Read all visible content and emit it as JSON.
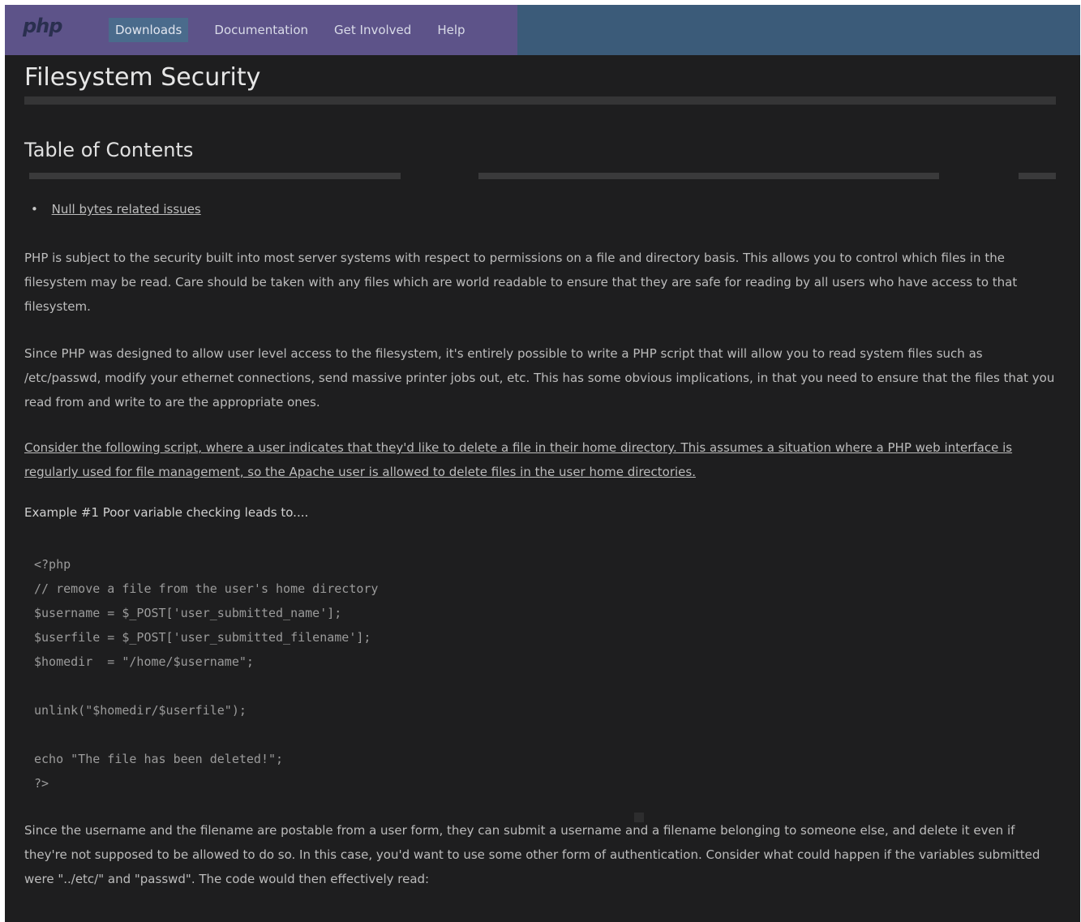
{
  "nav": {
    "logo": "php",
    "items": [
      "Downloads",
      "Documentation",
      "Get Involved",
      "Help"
    ]
  },
  "page": {
    "title": "Filesystem Security",
    "toc_title": "Table of Contents",
    "toc_items": [
      "Null bytes related issues"
    ]
  },
  "paragraphs": {
    "p1": "PHP is subject to the security built into most server systems with respect to permissions on a file and directory basis. This allows you to control which files in the filesystem may be read. Care should be taken with any files which are world readable to ensure that they are safe for reading by all users who have access to that filesystem.",
    "p2": "Since PHP was designed to allow user level access to the filesystem, it's entirely possible to write a PHP script that will allow you to read system files such as /etc/passwd, modify your ethernet connections, send massive printer jobs out, etc. This has some obvious implications, in that you need to ensure that the files that you read from and write to are the appropriate ones.",
    "p3_text": "Consider the following script, where a user indicates that they'd like to delete a file in their home directory. This assumes a situation where a PHP web interface is regularly used for file management, so the Apache user is allowed to delete files in the user home directories.",
    "p4": "Since the username and the filename are postable from a user form, they can submit a username and a filename belonging to someone else, and delete it even if they're not supposed to be allowed to do so. In this case, you'd want to use some other form of authentication. Consider what could happen if the variables submitted were \"../etc/\" and \"passwd\". The code would then effectively read:"
  },
  "example": {
    "title": "Example #1 Poor variable checking leads to....",
    "code_lines": [
      "<?php",
      "// remove a file from the user's home directory",
      "$username = $_POST['user_submitted_name'];",
      "$userfile = $_POST['user_submitted_filename'];",
      "$homedir  = \"/home/$username\";",
      "",
      "unlink(\"$homedir/$userfile\");",
      "",
      "echo \"The file has been deleted!\";",
      "?>"
    ]
  }
}
